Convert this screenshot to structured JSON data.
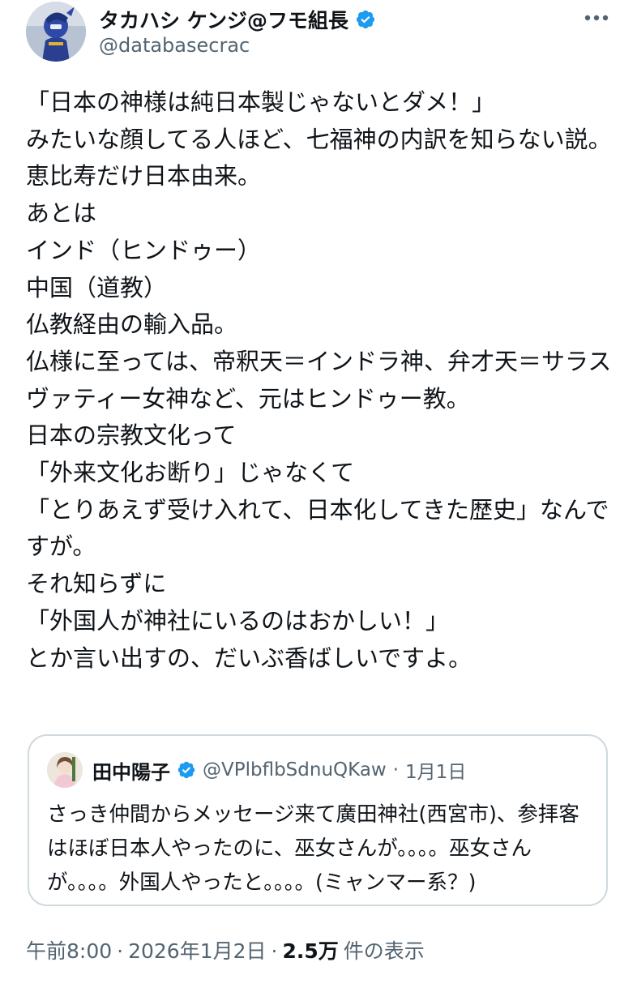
{
  "author": {
    "display_name": "タカハシ ケンジ@フモ組長",
    "handle": "@databasecrac",
    "verified": true,
    "avatar_icon": "knight-character-avatar"
  },
  "more_icon": "more-horizontal-icon",
  "tweet": {
    "text": "「日本の神様は純日本製じゃないとダメ！」\nみたいな顔してる人ほど、七福神の内訳を知らない説。\n恵比寿だけ日本由来。\nあとは\nインド（ヒンドゥー）\n中国（道教）\n仏教経由の輸入品。\n仏様に至っては、帝釈天＝インドラ神、弁才天＝サラスヴァティー女神など、元はヒンドゥー教。\n日本の宗教文化って\n「外来文化お断り」じゃなくて\n「とりあえず受け入れて、日本化してきた歴史」なんですが。\nそれ知らずに\n「外国人が神社にいるのはおかしい！」\nとか言い出すの、だいぶ香ばしいですよ。"
  },
  "quote": {
    "display_name": "田中陽子",
    "handle": "@VPlbflbSdnuQKaw",
    "separator": "·",
    "date": "1月1日",
    "verified": true,
    "text": "さっき仲間からメッセージ来て廣田神社(西宮市)、参拝客はほぼ日本人やったのに、巫女さんが。。。。巫女さんが。。。。外国人やったと。。。。(ミャンマー系？)"
  },
  "meta": {
    "time": "午前8:00",
    "sep1": "·",
    "date": "2026年1月2日",
    "sep2": "·",
    "views_count": "2.5万",
    "views_label": "件の表示"
  },
  "colors": {
    "text": "#0f1419",
    "secondary": "#536471",
    "verified_blue": "#1d9bf0",
    "border": "#cfd9de"
  }
}
